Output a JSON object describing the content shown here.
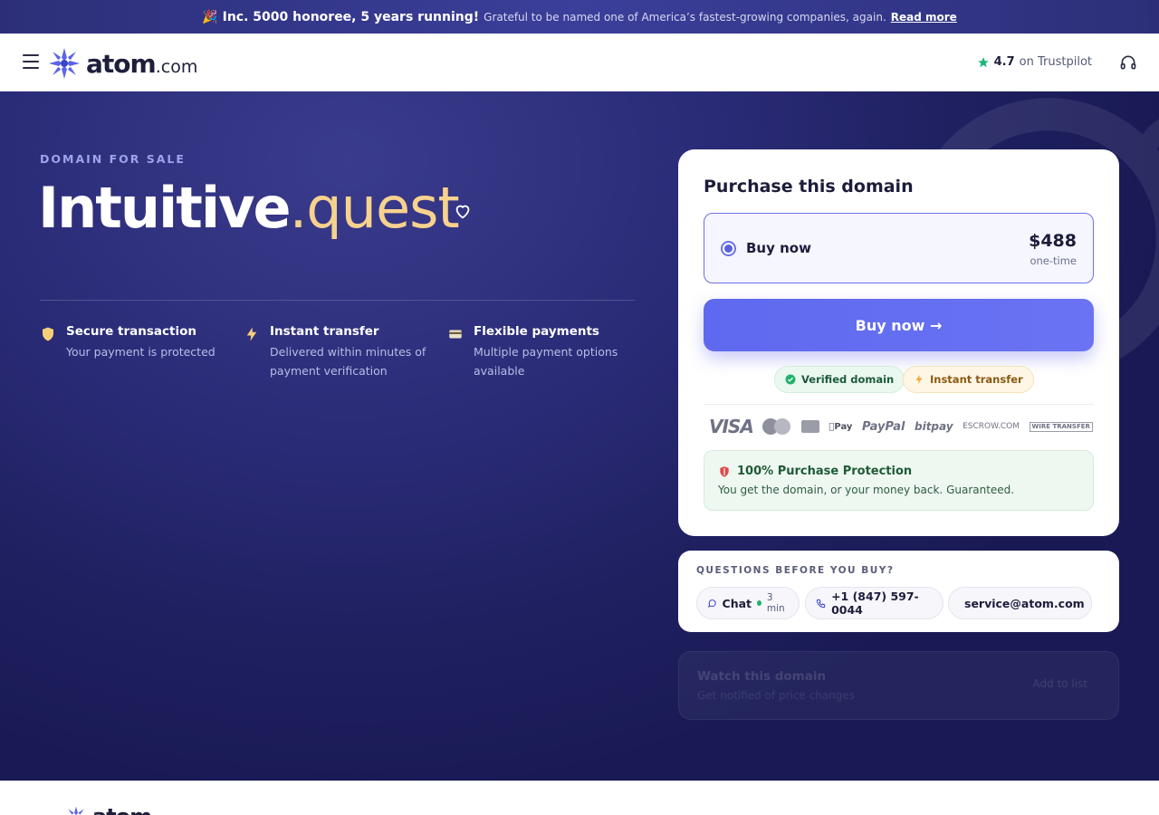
{
  "announcement": {
    "emoji": "🎉",
    "headline": "Inc. 5000 honoree, 5 years running!",
    "text": "Grateful to be named one of America’s fastest-growing companies, again.",
    "link": "Read more"
  },
  "header": {
    "logo_text": "atom",
    "logo_suffix": ".com",
    "trustpilot_score": "4.7",
    "trustpilot_label": "on Trustpilot",
    "accent_color": "#5a61e0"
  },
  "hero": {
    "tagline": "DOMAIN FOR SALE",
    "domain_name": "Intuitive",
    "domain_tld": ".quest",
    "features": [
      {
        "title": "Secure transaction",
        "description": "Your payment is protected",
        "icon": "shield-icon"
      },
      {
        "title": "Instant transfer",
        "description": "Delivered within minutes of payment verification",
        "icon": "lightning-icon"
      },
      {
        "title": "Flexible payments",
        "description": "Multiple payment options available",
        "icon": "card-icon"
      }
    ]
  },
  "purchase": {
    "title": "Purchase this domain",
    "option_label": "Buy now",
    "price": "$488",
    "price_note": "one-time",
    "button_label": "Buy now →",
    "badges": {
      "verified": "Verified domain",
      "instant": "Instant transfer"
    },
    "payment_methods": {
      "visa": "VISA",
      "mastercard": "MasterCard",
      "apple": "Pay",
      "paypal": "PayPal",
      "bitpay": "bitpay",
      "escrow": "ESCROW.COM",
      "wire": "WIRE TRANSFER"
    },
    "protection_title": "100% Purchase Protection",
    "protection_text": "You get the domain, or your money back. Guaranteed."
  },
  "questions": {
    "title": "QUESTIONS BEFORE YOU BUY?",
    "chat_label": "Chat",
    "chat_wait": "3 min",
    "phone": "+1 (847) 597-0044",
    "email": "service@atom.com"
  },
  "watch": {
    "title": "Watch this domain",
    "description": "Get notified of price changes",
    "button": "Add to list"
  },
  "footer": {
    "logo_text": "atom"
  }
}
